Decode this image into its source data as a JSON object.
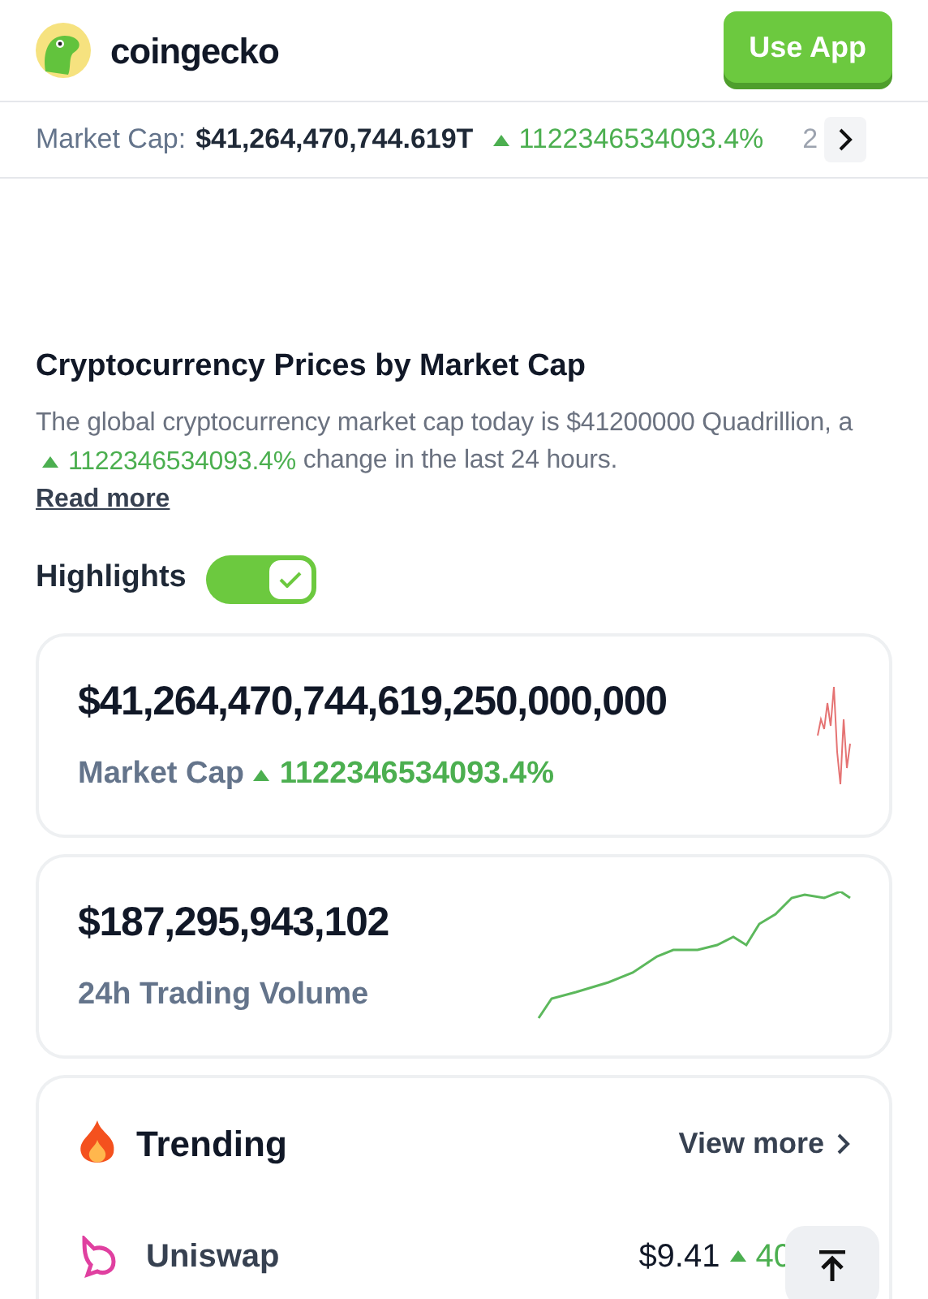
{
  "header": {
    "brand": "coingecko",
    "button": "Use App"
  },
  "ticker": {
    "label": "Market Cap:",
    "value": "$41,264,470,744.619T",
    "change": "1122346534093.4%",
    "next": "2"
  },
  "intro": {
    "title": "Cryptocurrency Prices by Market Cap",
    "text_before": "The global cryptocurrency market cap today is $41200000 Quadrillion, a",
    "change": "1122346534093.4%",
    "text_after": "change in the last 24 hours.",
    "link": "Read more"
  },
  "highlights": {
    "label": "Highlights",
    "on": true
  },
  "stats": [
    {
      "value": "$41,264,470,744,619,250,000,000",
      "label": "Market Cap",
      "change": "1122346534093.4%",
      "kind": "spikes"
    },
    {
      "value": "$187,295,943,102",
      "label": "24h Trading Volume",
      "kind": "line"
    }
  ],
  "trending": {
    "title": "Trending",
    "link": "View more",
    "rows": [
      {
        "name": "Uniswap",
        "price": "$9.41",
        "change": "40"
      }
    ]
  }
}
